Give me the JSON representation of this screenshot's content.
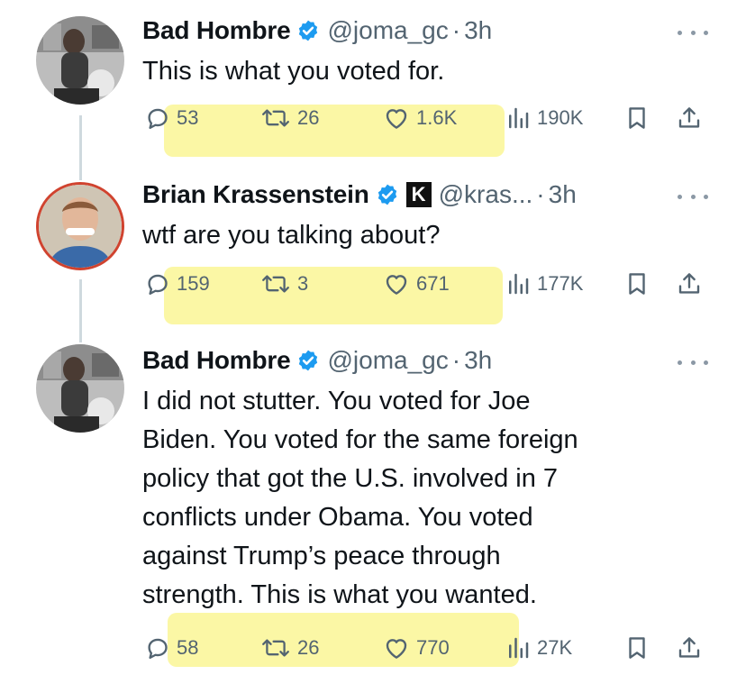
{
  "tweets": [
    {
      "name": "Bad Hombre",
      "handle": "@joma_gc",
      "separator": "·",
      "time": "3h",
      "text": "This is what you voted for.",
      "replies": "53",
      "reposts": "26",
      "likes": "1.6K",
      "views": "190K"
    },
    {
      "name": "Brian Krassenstein",
      "badge": "K",
      "handle": "@kras...",
      "separator": "·",
      "time": "3h",
      "text": "wtf are you talking about?",
      "replies": "159",
      "reposts": "3",
      "likes": "671",
      "views": "177K"
    },
    {
      "name": "Bad Hombre",
      "handle": "@joma_gc",
      "separator": "·",
      "time": "3h",
      "text_lines": [
        "I did not stutter. You voted for Joe",
        "Biden. You voted for the same foreign",
        "policy that got the U.S. involved in 7",
        "conflicts under Obama. You voted",
        "against Trump’s peace through",
        "strength. This is what you wanted."
      ],
      "replies": "58",
      "reposts": "26",
      "likes": "770",
      "views": "27K"
    }
  ],
  "colors": {
    "text": "#0f1419",
    "muted": "#536471",
    "verified": "#1d9bf0",
    "highlight": "#fbf7a0",
    "thread_line": "#cfd9de"
  },
  "icons": [
    "reply-icon",
    "repost-icon",
    "like-icon",
    "views-icon",
    "bookmark-icon",
    "share-icon",
    "verified-icon",
    "more-icon"
  ]
}
